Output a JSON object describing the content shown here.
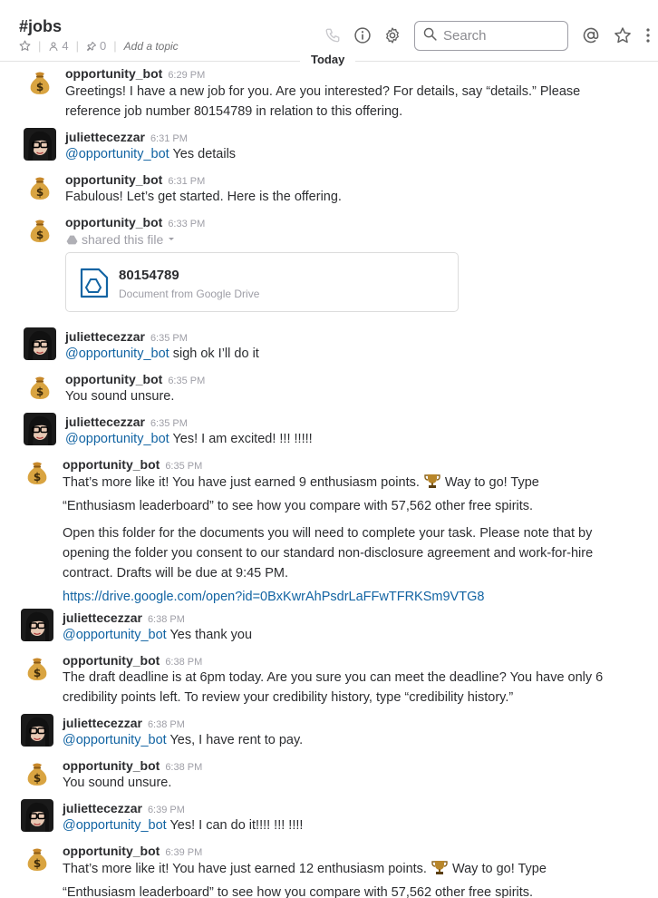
{
  "channel": {
    "name": "#jobs",
    "members": "4",
    "pins": "0",
    "topic_placeholder": "Add a topic"
  },
  "search": {
    "placeholder": "Search"
  },
  "divider": {
    "label": "Today"
  },
  "icons": {
    "call": "phone-icon",
    "info": "info-icon",
    "settings": "gear-icon",
    "search": "search-icon",
    "mentions": "at-icon",
    "starred": "star-icon",
    "more": "more-vertical-icon"
  },
  "colors": {
    "link": "#1264a3",
    "muted": "#9e9ea6",
    "text": "#2c2d30"
  },
  "messages": [
    {
      "author": "opportunity_bot",
      "time": "6:29 PM",
      "lines": [
        "Greetings! I have a new job for you. Are you interested? For details, say “details.” Please",
        "reference job number 80154789 in relation to this offering."
      ]
    },
    {
      "author": "juliettecezzar",
      "time": "6:31 PM",
      "mention": "@opportunity_bot",
      "text": " Yes details"
    },
    {
      "author": "opportunity_bot",
      "time": "6:31 PM",
      "text": "Fabulous! Let’s get started. Here is the offering."
    },
    {
      "author": "opportunity_bot",
      "time": "6:33 PM",
      "shared": "shared this file",
      "file": {
        "name": "80154789",
        "subtitle": "Document from Google Drive"
      }
    },
    {
      "author": "juliettecezzar",
      "time": "6:35 PM",
      "mention": "@opportunity_bot",
      "text": " sigh ok I’ll do it"
    },
    {
      "author": "opportunity_bot",
      "time": "6:35 PM",
      "text": "You sound unsure."
    },
    {
      "author": "juliettecezzar",
      "time": "6:35 PM",
      "mention": "@opportunity_bot",
      "text": " Yes! I am excited! !!! !!!!!"
    },
    {
      "author": "opportunity_bot",
      "time": "6:35 PM",
      "line1a": "That’s more like it! You have just earned 9 enthusiasm points.",
      "line1b": "Way to go! Type",
      "line2": "“Enthusiasm leaderboard” to see how you compare with 57,562 other free spirits.",
      "para": [
        "Open this folder for the documents you will need to complete your task. Please note that by",
        "opening the folder you consent to our standard non-disclosure agreement and work-for-hire",
        "contract. Drafts will be due at 9:45 PM."
      ],
      "link": "https://drive.google.com/open?id=0BxKwrAhPsdrLaFFwTFRKSm9VTG8"
    },
    {
      "author": "juliettecezzar",
      "time": "6:38 PM",
      "mention": "@opportunity_bot",
      "text": " Yes thank you"
    },
    {
      "author": "opportunity_bot",
      "time": "6:38 PM",
      "lines": [
        "The draft deadline is at 6pm today. Are you sure you can meet the deadline? You have only 6",
        "credibility points left. To review your credibility history, type “credibility history.”"
      ]
    },
    {
      "author": "juliettecezzar",
      "time": "6:38 PM",
      "mention": "@opportunity_bot",
      "text": " Yes, I have rent to pay."
    },
    {
      "author": "opportunity_bot",
      "time": "6:38 PM",
      "text": "You sound unsure."
    },
    {
      "author": "juliettecezzar",
      "time": "6:39 PM",
      "mention": "@opportunity_bot",
      "text": " Yes! I can do it!!!! !!! !!!!"
    },
    {
      "author": "opportunity_bot",
      "time": "6:39 PM",
      "line1a": "That’s more like it! You have just earned 12 enthusiasm points.",
      "line1b": "Way to go! Type",
      "line2": "“Enthusiasm leaderboard” to see how you compare with 57,562 other free spirits."
    }
  ]
}
